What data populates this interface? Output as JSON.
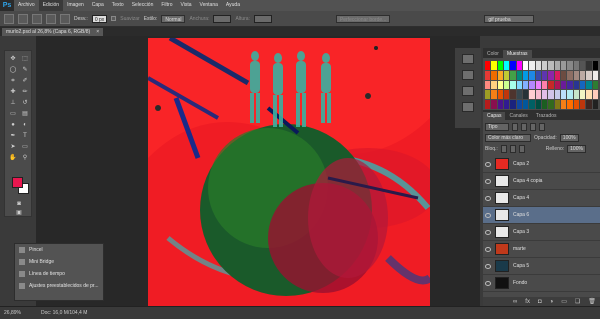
{
  "app": {
    "logo": "Ps"
  },
  "menu": [
    "Archivo",
    "Edición",
    "Imagen",
    "Capa",
    "Texto",
    "Selección",
    "Filtro",
    "Vista",
    "Ventana",
    "Ayuda"
  ],
  "options": {
    "feather_label": "Desv.:",
    "feather_value": "0 px",
    "smooth_label": "Suavizar",
    "style_label": "Estilo:",
    "style_value": "Normal",
    "width_label": "Anchura:",
    "height_label": "Altura:",
    "refine_label": "Perfeccionar borde...",
    "workspace": "gif prueba"
  },
  "document": {
    "tab_title": "murlo2.psd al 26,8% (Capa 6, RGB/8)",
    "close": "×"
  },
  "toolbar_icons": [
    "move-icon",
    "marquee-icon",
    "lasso-icon",
    "quick-select-icon",
    "crop-icon",
    "eyedropper-icon",
    "healing-icon",
    "brush-icon",
    "clone-stamp-icon",
    "history-brush-icon",
    "eraser-icon",
    "gradient-icon",
    "blur-icon",
    "dodge-icon",
    "pen-icon",
    "type-icon",
    "path-select-icon",
    "rectangle-icon",
    "hand-icon",
    "zoom-icon"
  ],
  "mini_panel": {
    "items": [
      "Pincel",
      "Mini Bridge",
      "Línea de tiempo",
      "Ajustes preestablecidos de pr..."
    ]
  },
  "status": {
    "zoom": "26,89%",
    "doc": "Doc: 16,0 M/104,4 M"
  },
  "colors": {
    "foreground": "#e8174f",
    "background": "#ffffff"
  },
  "swatch_panel": {
    "tabs": [
      "Color",
      "Muestras"
    ],
    "active": "Muestras"
  },
  "layers_panel": {
    "tabs": [
      "Capas",
      "Canales",
      "Trazados"
    ],
    "filter": "Tipo",
    "blend_mode": "Color más claro",
    "opacity_label": "Opacidad:",
    "opacity_value": "100%",
    "lock_label": "Bloq.:",
    "fill_label": "Relleno:",
    "fill_value": "100%",
    "layers": [
      {
        "name": "Capa 2",
        "thumb": "#e62a22",
        "selected": false
      },
      {
        "name": "Capa 4 copia",
        "thumb": "#e8e8e8",
        "selected": false
      },
      {
        "name": "Capa 4",
        "thumb": "#e8e8e8",
        "selected": false
      },
      {
        "name": "Capa 6",
        "thumb": "#e8e8e8",
        "selected": true
      },
      {
        "name": "Capa 3",
        "thumb": "#e8e8e8",
        "selected": false
      },
      {
        "name": "marte",
        "thumb": "#c0391b",
        "selected": false
      },
      {
        "name": "Capa 5",
        "thumb": "#1a3a4a",
        "selected": false
      },
      {
        "name": "Fondo",
        "thumb": "#111111",
        "selected": false
      }
    ]
  }
}
